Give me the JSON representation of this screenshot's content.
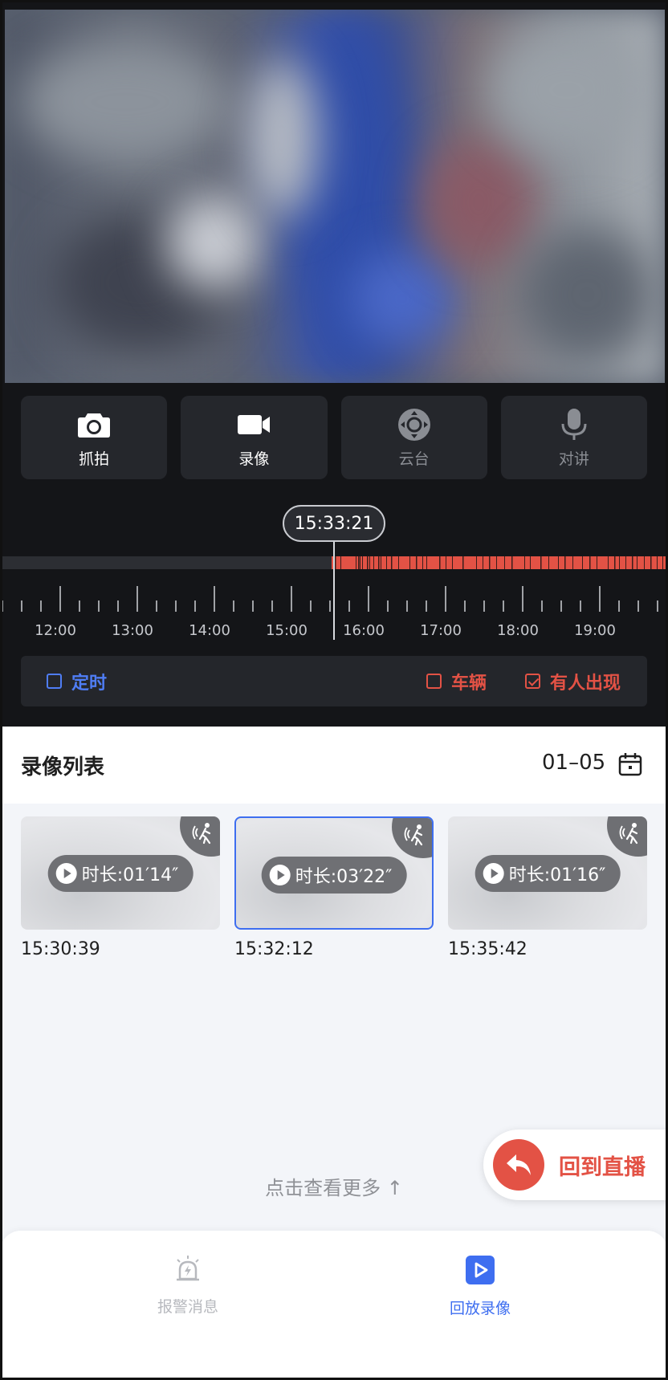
{
  "controls": [
    {
      "id": "snapshot",
      "label": "抓拍",
      "icon": "camera-icon",
      "enabled": true
    },
    {
      "id": "record",
      "label": "录像",
      "icon": "video-camera-icon",
      "enabled": true
    },
    {
      "id": "ptz",
      "label": "云台",
      "icon": "ptz-joystick-icon",
      "enabled": false
    },
    {
      "id": "talk",
      "label": "对讲",
      "icon": "microphone-icon",
      "enabled": false
    }
  ],
  "timeline": {
    "current_time": "15:33:21",
    "tick_labels": [
      "12:00",
      "13:00",
      "14:00",
      "15:00",
      "16:00",
      "17:00",
      "18:00",
      "19:00"
    ],
    "recorded_color": "#e35245"
  },
  "filters": {
    "timed": {
      "label": "定时",
      "checked": false,
      "color": "#4f7df5"
    },
    "vehicle": {
      "label": "车辆",
      "checked": false,
      "color": "#e35245"
    },
    "person": {
      "label": "有人出现",
      "checked": true,
      "color": "#e35245"
    }
  },
  "list": {
    "title": "录像列表",
    "date": "01–05",
    "calendar_icon": "calendar-icon",
    "clips": [
      {
        "duration": "时长:01′14″",
        "time": "15:30:39",
        "selected": false,
        "icon": "motion-person-icon"
      },
      {
        "duration": "时长:03′22″",
        "time": "15:32:12",
        "selected": true,
        "icon": "motion-person-icon"
      },
      {
        "duration": "时长:01′16″",
        "time": "15:35:42",
        "selected": false,
        "icon": "motion-person-icon"
      }
    ],
    "more_label": "点击查看更多 ↑"
  },
  "back_to_live": {
    "label": "回到直播",
    "icon": "return-arrow-icon"
  },
  "nav": {
    "alarm": {
      "label": "报警消息",
      "icon": "alarm-siren-icon",
      "active": false
    },
    "playback": {
      "label": "回放录像",
      "icon": "playback-icon",
      "active": true
    },
    "active_color": "#3e6ef0",
    "inactive_color": "#b7b9be"
  }
}
